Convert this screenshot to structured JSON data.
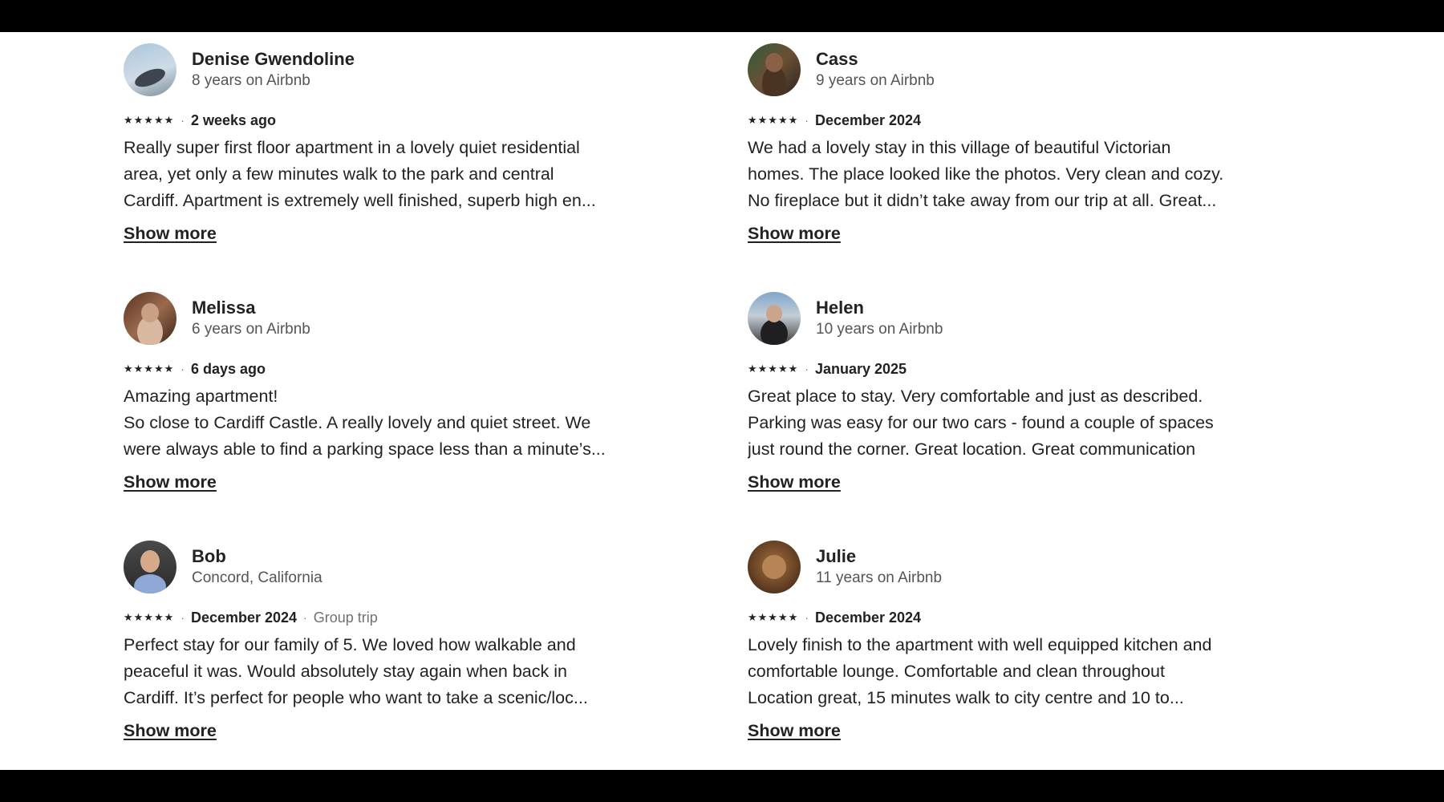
{
  "colors": {
    "text": "#222222",
    "secondary": "#717171",
    "background": "#ffffff",
    "letterbox": "#000000"
  },
  "reviews": [
    {
      "name": "Denise Gwendoline",
      "subtitle": "8 years on Airbnb",
      "stars": "★★★★★",
      "date": "2 weeks ago",
      "trip_type": "",
      "text": "Really super first floor apartment in a lovely quiet residential\narea, yet only a few minutes walk to the park and central\nCardiff. Apartment is extremely well finished, superb high en...",
      "show_more": "Show more"
    },
    {
      "name": "Cass",
      "subtitle": "9 years on Airbnb",
      "stars": "★★★★★",
      "date": "December 2024",
      "trip_type": "",
      "text": "We had a lovely stay in this village of beautiful Victorian\nhomes. The place looked like the photos. Very clean and cozy.\nNo fireplace but it didn’t take away from our trip at all. Great...",
      "show_more": "Show more"
    },
    {
      "name": "Melissa",
      "subtitle": "6 years on Airbnb",
      "stars": "★★★★★",
      "date": "6 days ago",
      "trip_type": "",
      "text": "Amazing apartment!\nSo close to Cardiff Castle. A really lovely and quiet street. We\nwere always able to find a parking space less than a minute’s...",
      "show_more": "Show more"
    },
    {
      "name": "Helen",
      "subtitle": "10 years on Airbnb",
      "stars": "★★★★★",
      "date": "January 2025",
      "trip_type": "",
      "text": "Great place to stay. Very comfortable and just as described.\nParking was easy for our two cars - found a couple of spaces\njust round the corner. Great location. Great communication",
      "show_more": "Show more"
    },
    {
      "name": "Bob",
      "subtitle": "Concord, California",
      "stars": "★★★★★",
      "date": "December 2024",
      "trip_type": "Group trip",
      "text": "Perfect stay for our family of 5. We loved how walkable and\npeaceful it was. Would absolutely stay again when back in\nCardiff. It’s perfect for people who want to take a scenic/loc...",
      "show_more": "Show more"
    },
    {
      "name": "Julie",
      "subtitle": "11 years on Airbnb",
      "stars": "★★★★★",
      "date": "December 2024",
      "trip_type": "",
      "text": "Lovely finish to the apartment with well equipped kitchen and\ncomfortable lounge. Comfortable and clean throughout\nLocation great, 15 minutes walk to city centre and 10 to...",
      "show_more": "Show more"
    }
  ]
}
